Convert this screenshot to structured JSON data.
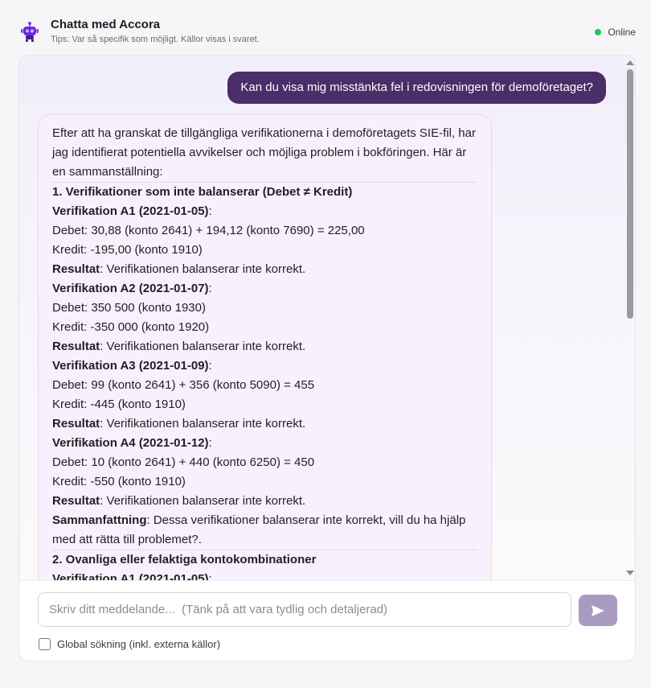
{
  "header": {
    "title": "Chatta med Accora",
    "subtitle": "Tips: Var så specifik som möjligt. Källor visas i svaret.",
    "status": "Online",
    "status_color": "#22c55e"
  },
  "messages": {
    "user": "Kan du visa mig misstänkta fel i redovisningen för demoföretaget?",
    "bot": {
      "intro": "Efter att ha granskat de tillgängliga verifikationerna i demoföretagets SIE-fil, har jag identifierat potentiella avvikelser och möjliga problem i bokföringen. Här är en sammanställning:",
      "section1_title": "1. Verifikationer som inte balanserar (Debet ≠ Kredit)",
      "verifications": [
        {
          "title": "Verifikation A1 (2021-01-05)",
          "debet": "Debet: 30,88 (konto 2641) + 194,12 (konto 7690) = 225,00",
          "kredit": "Kredit: -195,00 (konto 1910)",
          "result_label": "Resultat",
          "result_text": ": Verifikationen balanserar inte korrekt."
        },
        {
          "title": "Verifikation A2 (2021-01-07)",
          "debet": "Debet: 350 500 (konto 1930)",
          "kredit": "Kredit: -350 000 (konto 1920)",
          "result_label": "Resultat",
          "result_text": ": Verifikationen balanserar inte korrekt."
        },
        {
          "title": "Verifikation A3 (2021-01-09)",
          "debet": "Debet: 99 (konto 2641) + 356 (konto 5090) = 455",
          "kredit": "Kredit: -445 (konto 1910)",
          "result_label": "Resultat",
          "result_text": ": Verifikationen balanserar inte korrekt."
        },
        {
          "title": "Verifikation A4 (2021-01-12)",
          "debet": "Debet: 10 (konto 2641) + 440 (konto 6250) = 450",
          "kredit": "Kredit: -550 (konto 1910)",
          "result_label": "Resultat",
          "result_text": ": Verifikationen balanserar inte korrekt."
        }
      ],
      "summary_label": "Sammanfattning",
      "summary_text": ": Dessa verifikationer balanserar inte korrekt, vill du ha hjälp med att rätta till problemet?.",
      "section2_title": "2. Ovanliga eller felaktiga kontokombinationer",
      "section2_first": "Verifikation A1 (2021-01-05)"
    }
  },
  "composer": {
    "placeholder": "Skriv ditt meddelande...  (Tänk på att vara tydlig och detaljerad)",
    "send_icon": "send-arrow",
    "global_search_label": "Global sökning (inkl. externa källor)",
    "global_search_checked": false
  }
}
